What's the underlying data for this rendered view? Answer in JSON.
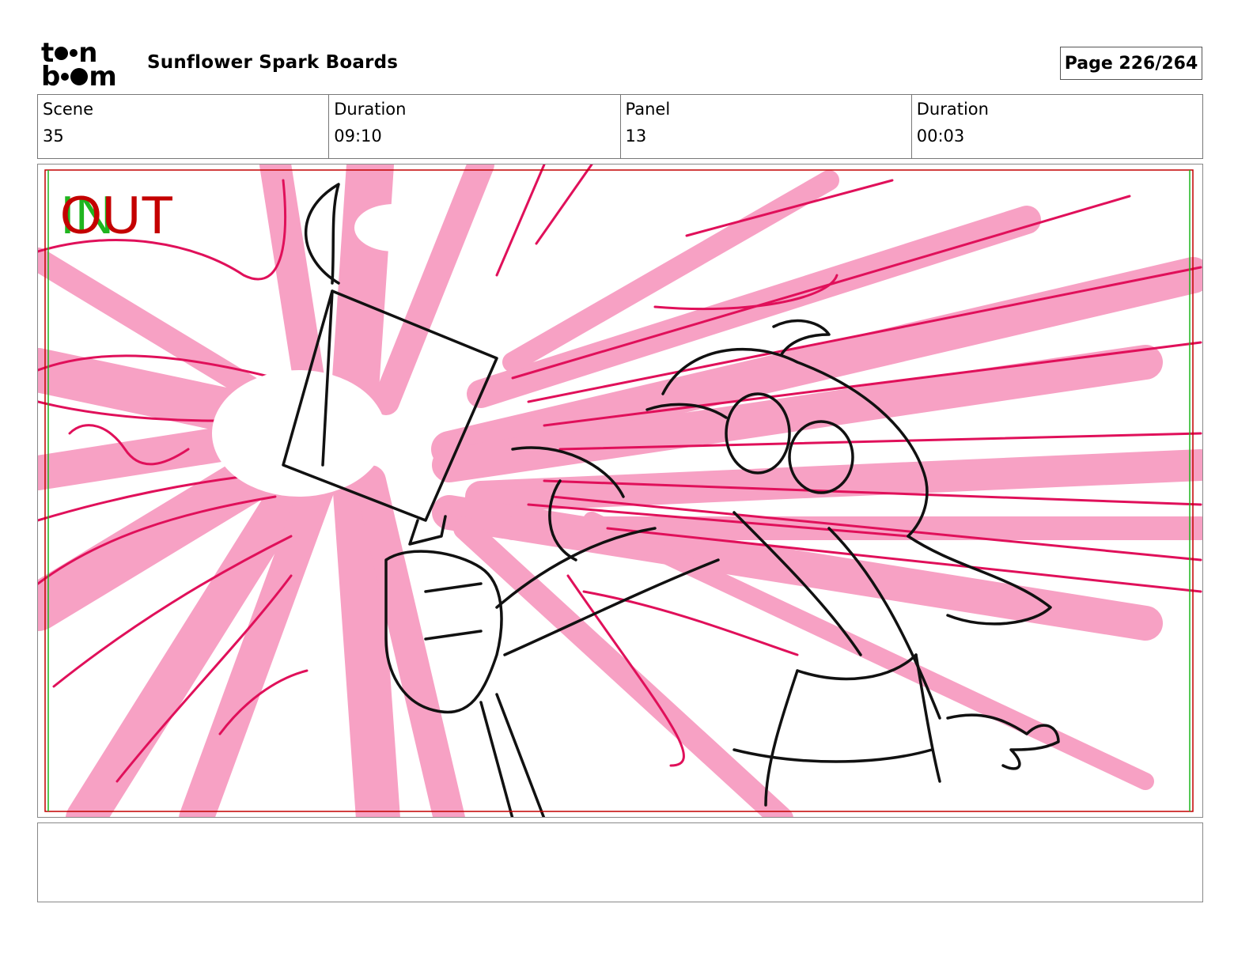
{
  "header": {
    "logo": {
      "top": "toon",
      "bottom": "boom"
    },
    "title": "Sunflower Spark Boards",
    "page": "Page 226/264"
  },
  "info": [
    {
      "label": "Scene",
      "value": "35"
    },
    {
      "label": "Duration",
      "value": "09:10"
    },
    {
      "label": "Panel",
      "value": "13"
    },
    {
      "label": "Duration",
      "value": "00:03"
    }
  ],
  "panel": {
    "in_marker": "IN",
    "out_marker": "OUT",
    "colors": {
      "burst_pink": "#f7a1c4",
      "stroke_magenta": "#e0105a",
      "line_black": "#111111",
      "frame_red": "#c40000",
      "frame_green": "#1fb51f"
    }
  },
  "notes": {
    "text": ""
  }
}
